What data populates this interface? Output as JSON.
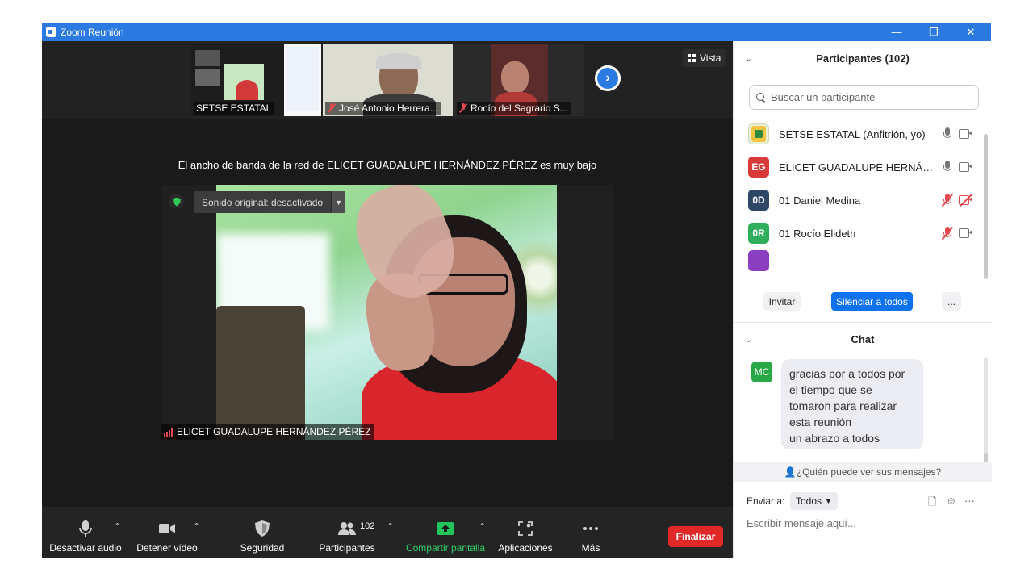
{
  "window": {
    "title": "Zoom Reunión",
    "controls": [
      "—",
      "❐",
      "✕"
    ]
  },
  "strip": {
    "thumbs": [
      {
        "name": "SETSE ESTATAL",
        "muted": false
      },
      {
        "name": "José Antonio Herrera...",
        "muted": true
      },
      {
        "name": "Rocío del Sagrario S...",
        "muted": true
      }
    ],
    "view_label": "Vista"
  },
  "banner": "El ancho de banda de la red de ELICET GUADALUPE HERNÁNDEZ PÉREZ es muy bajo",
  "main_video": {
    "sound_label": "Sonido original: desactivado",
    "speaker_name": "ELICET GUADALUPE HERNÁNDEZ PÉREZ"
  },
  "toolbar": {
    "mute": "Desactivar audio",
    "video": "Detener vídeo",
    "security": "Seguridad",
    "participants": "Participantes",
    "participant_count": "102",
    "share": "Compartir pantalla",
    "apps": "Aplicaciones",
    "more": "Más",
    "end": "Finalizar"
  },
  "participants_panel": {
    "title": "Participantes (102)",
    "search_placeholder": "Buscar un participante",
    "list": [
      {
        "initials": "",
        "name": "SETSE ESTATAL (Anfitrión, yo)",
        "color": "#e9efd6",
        "mic_off": false,
        "cam_off": false
      },
      {
        "initials": "EG",
        "name": "ELICET GUADALUPE HERNÁNDEZ PÉREZ",
        "color": "#d93a3a",
        "mic_off": false,
        "cam_off": false
      },
      {
        "initials": "0D",
        "name": "01 Daniel Medina",
        "color": "#2f4766",
        "mic_off": true,
        "cam_off": true
      },
      {
        "initials": "0R",
        "name": "01 Rocío Elideth",
        "color": "#2fae5c",
        "mic_off": true,
        "cam_off": false
      }
    ],
    "invite": "Invitar",
    "mute_all": "Silenciar a todos",
    "more": "..."
  },
  "chat": {
    "title": "Chat",
    "sender_initials": "MC",
    "message_lines": [
      "gracias por a todos por",
      "el tiempo que se",
      "tomaron para realizar",
      "esta reunión",
      "un abrazo a todos"
    ],
    "who_can_see": "¿Quién puede ver sus mensajes?",
    "send_to_label": "Enviar a:",
    "send_to_value": "Todos",
    "input_placeholder": "Escribir mensaje aquí..."
  },
  "colors": {
    "titlebar": "#2a7ae2",
    "accent": "#0e72ed",
    "end_button": "#e02828",
    "share_green": "#22c55e"
  }
}
